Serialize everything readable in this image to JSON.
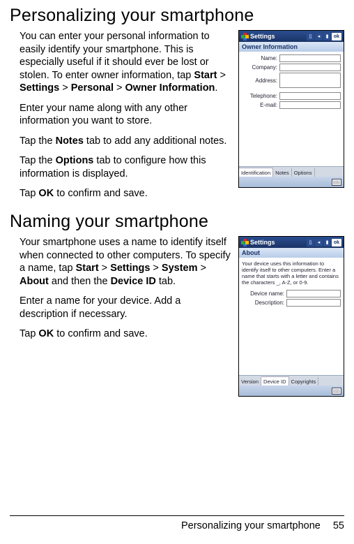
{
  "heading1": "Personalizing your smartphone",
  "section1": {
    "p1a": "You can enter your personal informa­tion to easily identify your smartphone. This is especially useful if it should ever be lost or stolen. To enter owner infor­mation, tap ",
    "start": "Start",
    "gt1": " > ",
    "settings": "Settings",
    "gt2": " > ",
    "personal": "Personal",
    "gt3": " > ",
    "owner": "Owner Information",
    "p1b": ".",
    "p2": "Enter your name along with any other information you want to store.",
    "p3a": "Tap the ",
    "notes": "Notes",
    "p3b": " tab to add any additional notes.",
    "p4a": "Tap the ",
    "options": "Options",
    "p4b": " tab to configure how this information is displayed.",
    "p5a": "Tap ",
    "ok": "OK",
    "p5b": " to confirm and save."
  },
  "device1": {
    "title": "Settings",
    "okLabel": "ok",
    "subtitle": "Owner Information",
    "fields": {
      "name": "Name:",
      "company": "Company:",
      "address": "Address:",
      "telephone": "Telephone:",
      "email": "E-mail:"
    },
    "tabs": {
      "t1": "Identification",
      "t2": "Notes",
      "t3": "Options"
    }
  },
  "heading2": "Naming your smartphone",
  "section2": {
    "p1a": "Your smartphone uses a name to iden­tify itself when connected to other computers. To specify a name, tap ",
    "start": "Start",
    "gt1": " > ",
    "settings": "Settings",
    "gt2": " > ",
    "system": "System",
    "gt3": " > ",
    "about": "About",
    "p1b": " and then the ",
    "deviceid": "Device ID",
    "p1c": " tab.",
    "p2": "Enter a name for your device. Add a description if necessary.",
    "p3a": "Tap ",
    "ok": "OK",
    "p3b": " to confirm and save."
  },
  "device2": {
    "title": "Settings",
    "okLabel": "ok",
    "subtitle": "About",
    "help": "Your device uses this information to identify itself to other computers. Enter a name that starts with a letter and contains the characters _, A-Z, or 0-9.",
    "fields": {
      "dname": "Device name:",
      "desc": "Description:"
    },
    "tabs": {
      "t1": "Version",
      "t2": "Device ID",
      "t3": "Copyrights"
    }
  },
  "footer": {
    "title": "Personalizing your smartphone",
    "page": "55"
  }
}
